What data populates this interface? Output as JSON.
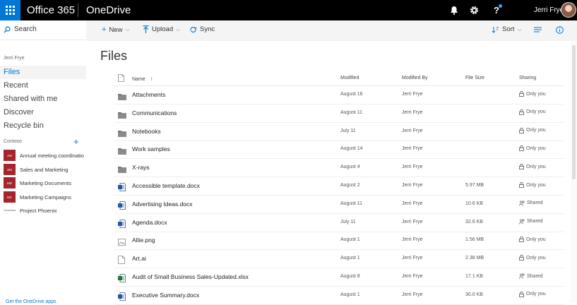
{
  "topbar": {
    "suite": "Office 365",
    "app": "OneDrive",
    "user_name": "Jerri Frye",
    "help_glyph": "?"
  },
  "leftnav": {
    "search_label": "Search",
    "user": "Jerri Frye",
    "items": [
      {
        "label": "Files",
        "active": true
      },
      {
        "label": "Recent"
      },
      {
        "label": "Shared with me"
      },
      {
        "label": "Discover"
      },
      {
        "label": "Recycle bin"
      }
    ],
    "section": "Contoso",
    "add_glyph": "+",
    "groups": [
      {
        "badge": "AM",
        "label": "Annual meeting coordinatio"
      },
      {
        "badge": "SM",
        "label": "Sales and Marketing"
      },
      {
        "badge": "MD",
        "label": "Marketing Documents"
      },
      {
        "badge": "MC",
        "label": "Marketing Campaigns"
      },
      {
        "badge": "Oceanbase",
        "label": "Project Phoenix"
      }
    ],
    "get_app": "Get the OneDrive apps"
  },
  "commands": {
    "new": "New",
    "upload": "Upload",
    "sync": "Sync",
    "sort": "Sort"
  },
  "main": {
    "title": "Files",
    "columns": {
      "name": "Name",
      "modified": "Modified",
      "modified_by": "Modified By",
      "file_size": "File Size",
      "sharing": "Sharing"
    },
    "sort_arrow": "↑",
    "rows": [
      {
        "name": "Attachments",
        "type": "folder",
        "modified": "August 16",
        "by": "Jerri Frye",
        "size": "",
        "sharing": "Only you",
        "shared": false
      },
      {
        "name": "Communications",
        "type": "folder",
        "modified": "August 11",
        "by": "Jerri Frye",
        "size": "",
        "sharing": "Only you",
        "shared": false
      },
      {
        "name": "Notebooks",
        "type": "folder",
        "modified": "July 11",
        "by": "Jerri Frye",
        "size": "",
        "sharing": "Only you",
        "shared": false
      },
      {
        "name": "Work samples",
        "type": "folder",
        "modified": "August 14",
        "by": "Jerri Frye",
        "size": "",
        "sharing": "Only you",
        "shared": false
      },
      {
        "name": "X-rays",
        "type": "folder",
        "modified": "August 4",
        "by": "Jerri Frye",
        "size": "",
        "sharing": "Only you",
        "shared": false
      },
      {
        "name": "Accessible template.docx",
        "type": "word",
        "modified": "August 2",
        "by": "Jerri Frye",
        "size": "5.97 MB",
        "sharing": "Only you",
        "shared": false
      },
      {
        "name": "Advertising Ideas.docx",
        "type": "word",
        "modified": "August 11",
        "by": "Jerri Frye",
        "size": "10.6 KB",
        "sharing": "Shared",
        "shared": true
      },
      {
        "name": "Agenda.docx",
        "type": "word",
        "modified": "July 11",
        "by": "Jerri Frye",
        "size": "32.6 KB",
        "sharing": "Shared",
        "shared": true
      },
      {
        "name": "Allie.png",
        "type": "image",
        "modified": "August 1",
        "by": "Jerri Frye",
        "size": "1.56 MB",
        "sharing": "Only you",
        "shared": false
      },
      {
        "name": "Art.ai",
        "type": "generic",
        "modified": "August 1",
        "by": "Jerri Frye",
        "size": "2.38 MB",
        "sharing": "Only you",
        "shared": false
      },
      {
        "name": "Audit of Small Business Sales-Updated.xlsx",
        "type": "excel",
        "modified": "August 8",
        "by": "Jerri Frye",
        "size": "17.1 KB",
        "sharing": "Shared",
        "shared": true
      },
      {
        "name": "Executive Summary.docx",
        "type": "word",
        "modified": "August 1",
        "by": "Jerri Frye",
        "size": "30.0 KB",
        "sharing": "Only you",
        "shared": false
      }
    ]
  },
  "colors": {
    "accent": "#0078d7",
    "topbar": "#000000",
    "group_badge": "#a4262c",
    "word": "#2b579a",
    "excel": "#217346",
    "folder": "#767676"
  }
}
